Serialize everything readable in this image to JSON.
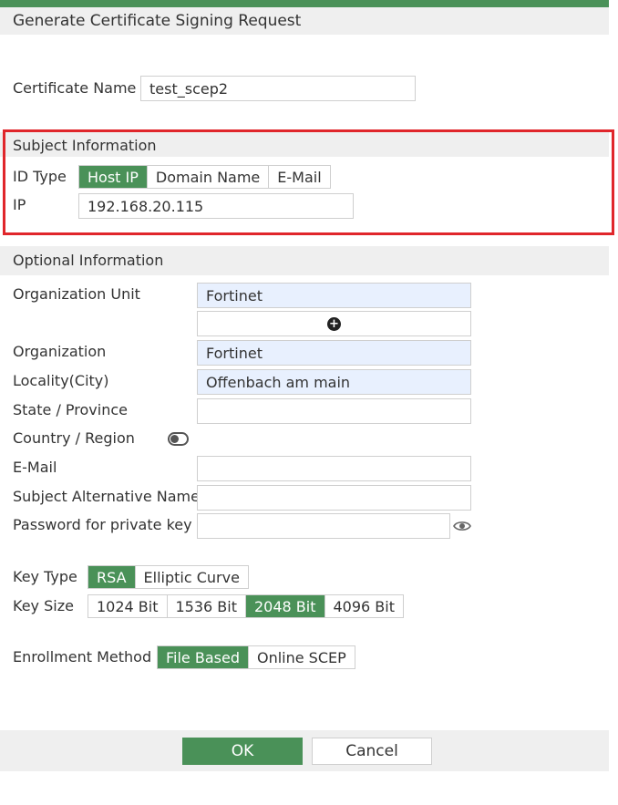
{
  "dialog": {
    "title": "Generate Certificate Signing Request"
  },
  "certificate": {
    "label": "Certificate Name",
    "value": "test_scep2"
  },
  "subject": {
    "section_title": "Subject Information",
    "id_type_label": "ID Type",
    "id_type_options": [
      "Host IP",
      "Domain Name",
      "E-Mail"
    ],
    "id_type_selected": "Host IP",
    "ip_label": "IP",
    "ip_value": "192.168.20.115"
  },
  "optional": {
    "section_title": "Optional Information",
    "org_unit_label": "Organization Unit",
    "org_unit_value": "Fortinet",
    "organization_label": "Organization",
    "organization_value": "Fortinet",
    "locality_label": "Locality(City)",
    "locality_value": "Offenbach am main",
    "state_label": "State / Province",
    "state_value": "",
    "country_label": "Country / Region",
    "country_toggle": "off",
    "email_label": "E-Mail",
    "email_value": "",
    "san_label": "Subject Alternative Name",
    "san_value": "",
    "password_label": "Password for private key",
    "password_value": ""
  },
  "key": {
    "type_label": "Key Type",
    "type_options": [
      "RSA",
      "Elliptic Curve"
    ],
    "type_selected": "RSA",
    "size_label": "Key Size",
    "size_options": [
      "1024 Bit",
      "1536 Bit",
      "2048 Bit",
      "4096 Bit"
    ],
    "size_selected": "2048 Bit"
  },
  "enrollment": {
    "label": "Enrollment Method",
    "options": [
      "File Based",
      "Online SCEP"
    ],
    "selected": "File Based"
  },
  "footer": {
    "ok_label": "OK",
    "cancel_label": "Cancel"
  },
  "colors": {
    "accent": "#4a9158",
    "highlight_border": "#e0262b",
    "autofill_bg": "#e8f0fe"
  },
  "icons": {
    "add": "plus-circle-icon",
    "password_reveal": "eye-icon",
    "country_toggle": "toggle-icon"
  }
}
